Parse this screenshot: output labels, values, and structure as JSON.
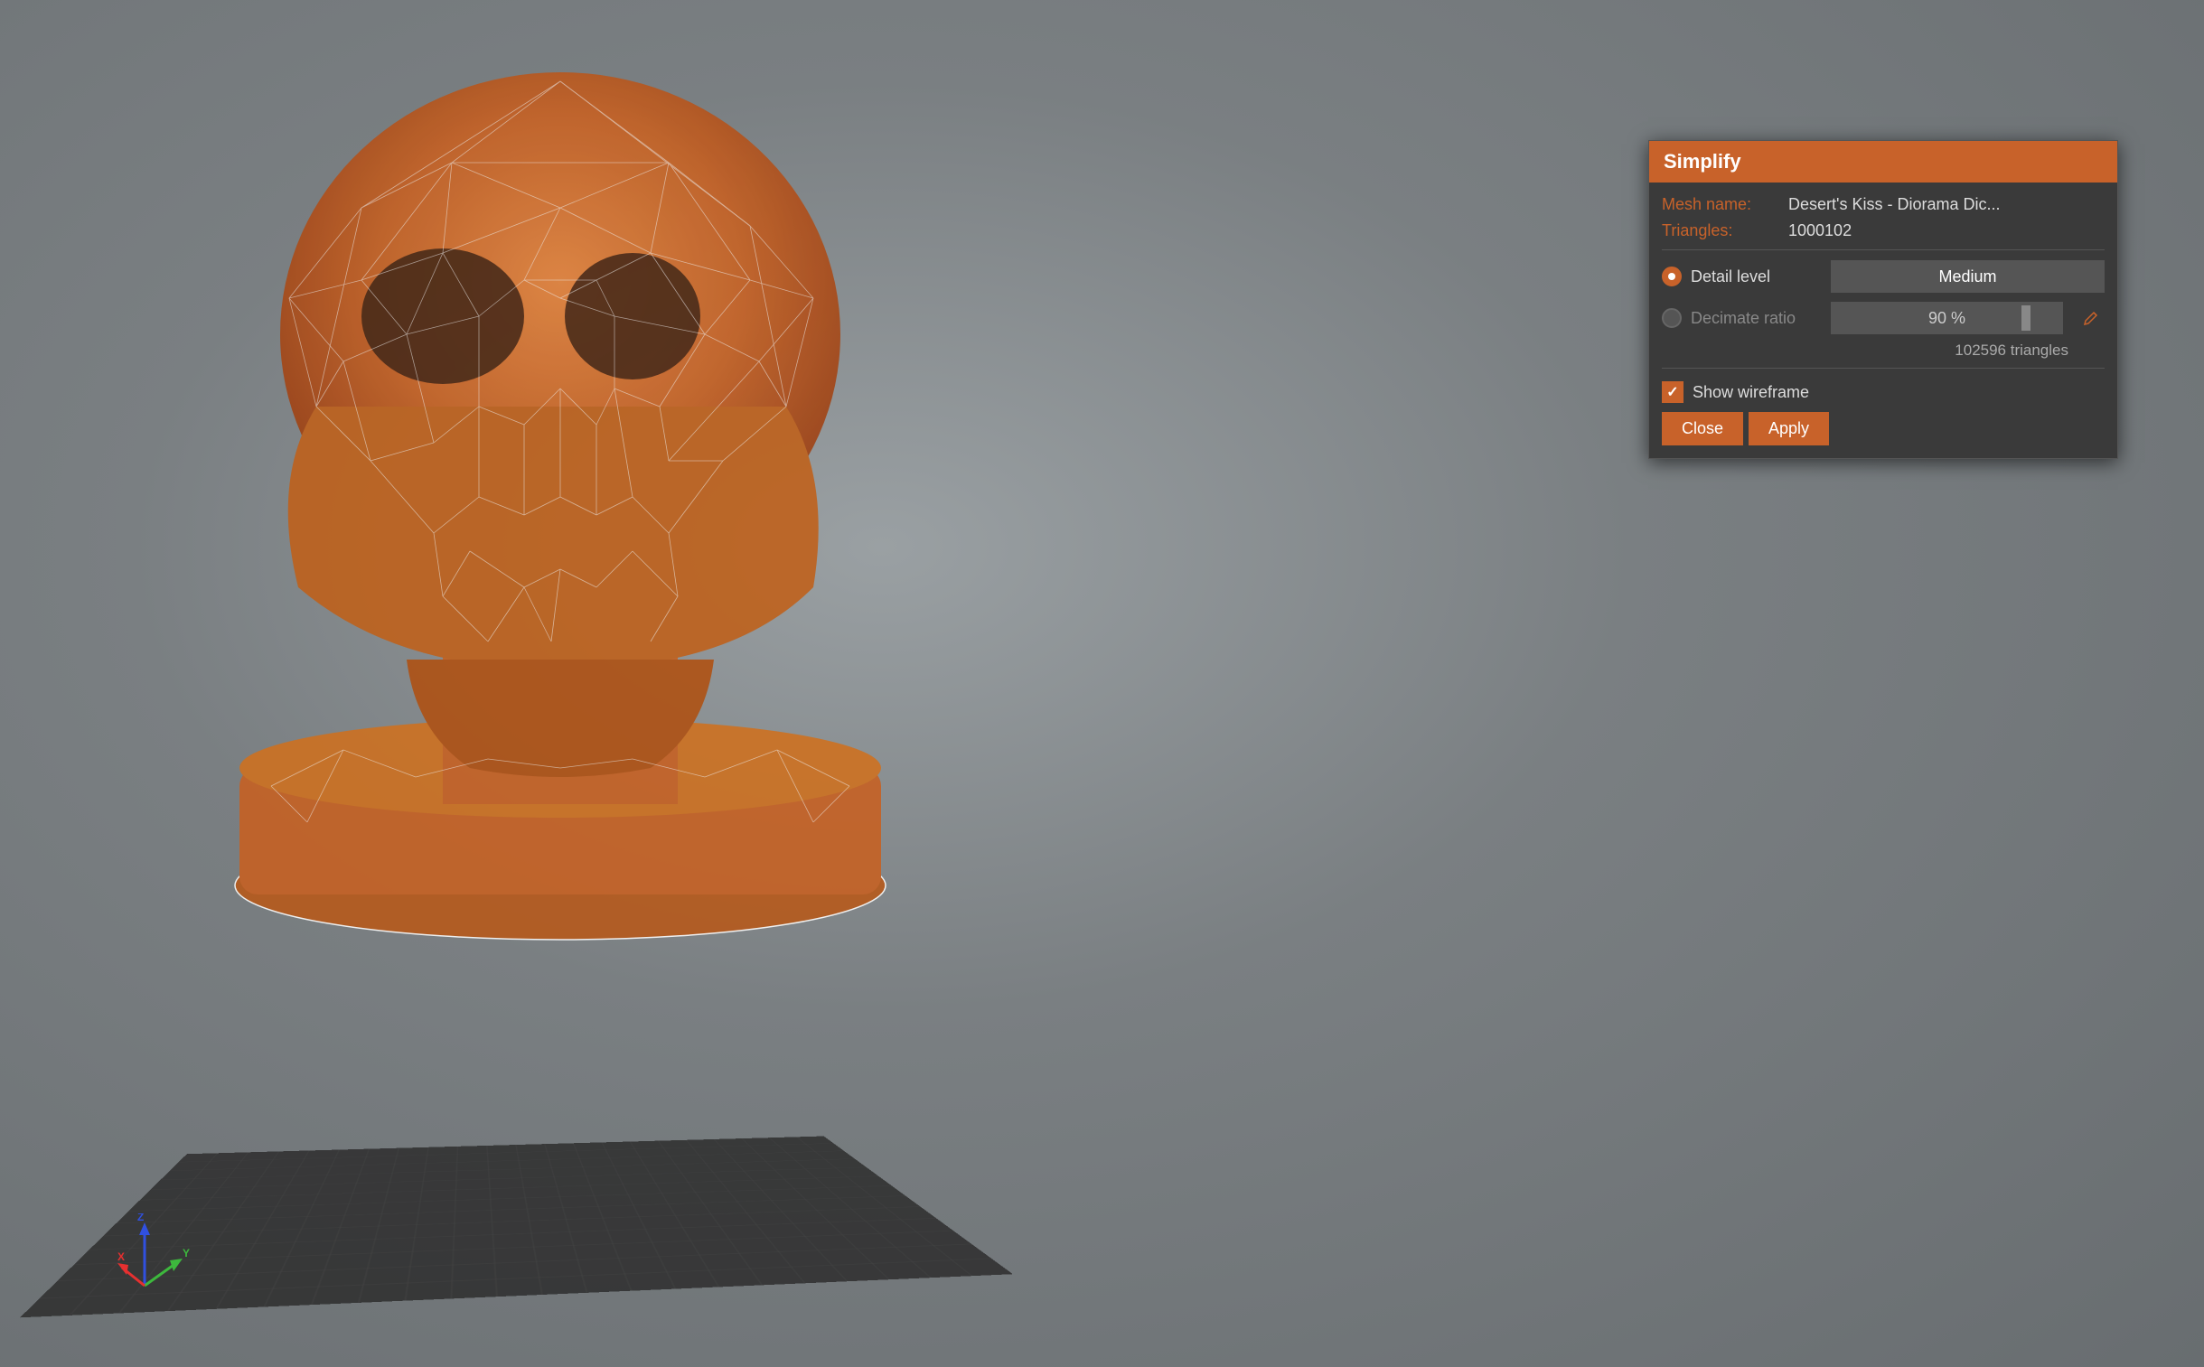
{
  "viewport": {
    "background_color": "#888b8d"
  },
  "panel": {
    "title": "Simplify",
    "title_bar_color": "#c8622a",
    "mesh_name_label": "Mesh name:",
    "mesh_name_value": "Desert's Kiss - Diorama Dic...",
    "triangles_label": "Triangles:",
    "triangles_value": "1000102",
    "detail_level_label": "Detail level",
    "detail_level_value": "Medium",
    "decimate_ratio_label": "Decimate ratio",
    "decimate_ratio_value": "90 %",
    "triangle_count": "102596 triangles",
    "show_wireframe_label": "Show wireframe",
    "show_wireframe_checked": true,
    "close_button_label": "Close",
    "apply_button_label": "Apply",
    "detail_level_active": true,
    "decimate_ratio_active": false
  },
  "axis": {
    "x_color": "#e63030",
    "y_color": "#3db83d",
    "z_color": "#3050e0"
  }
}
